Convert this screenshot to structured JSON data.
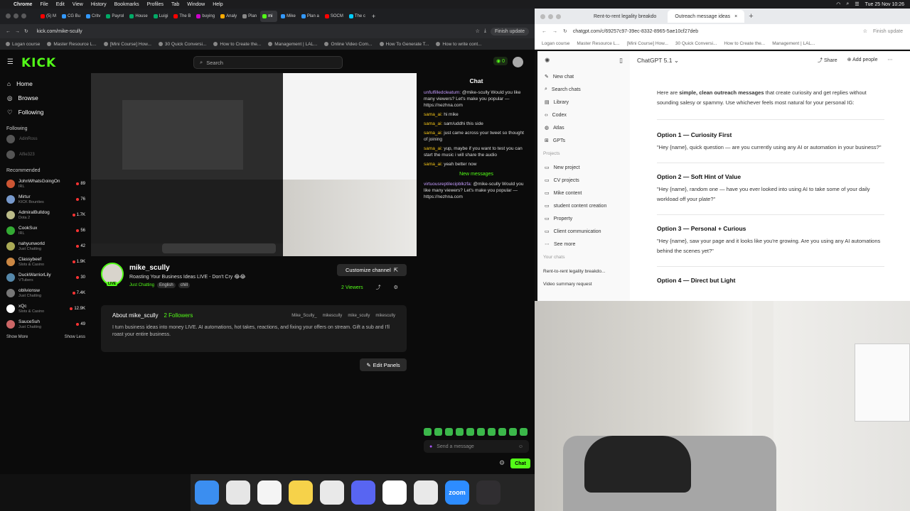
{
  "menubar": {
    "app": "Chrome",
    "items": [
      "File",
      "Edit",
      "View",
      "History",
      "Bookmarks",
      "Profiles",
      "Tab",
      "Window",
      "Help"
    ],
    "datetime": "Tue 25 Nov 10:26"
  },
  "left_browser": {
    "tabs": [
      "(5) M",
      "CG Bu",
      "Critv",
      "Payrol",
      "House",
      "Luigi",
      "The B",
      "buying",
      "Analy",
      "Plan",
      "mi",
      "Mike",
      "Plan a",
      "SOCM",
      "The c"
    ],
    "url": "kick.com/mike-scully",
    "finish_update": "Finish update",
    "bookmarks": [
      "Logan course",
      "Master Resource L...",
      "[Mini Course] How...",
      "30 Quick Conversi...",
      "How to Create the...",
      "Management | LAL...",
      "Online Video Com...",
      "How To Generate T...",
      "How to write cont..."
    ]
  },
  "kick": {
    "search_placeholder": "Search",
    "notif_count": "0",
    "nav": [
      {
        "label": "Home",
        "icon": "home-icon"
      },
      {
        "label": "Browse",
        "icon": "compass-icon"
      },
      {
        "label": "Following",
        "icon": "heart-icon"
      }
    ],
    "following_title": "Following",
    "following": [
      "AdinRoss",
      "Alfie323"
    ],
    "recommended_title": "Recommended",
    "recommended": [
      {
        "name": "JohnWhatsGoingOn",
        "cat": "IRL",
        "viewers": "89"
      },
      {
        "name": "Mirtur",
        "cat": "KICK Bounties",
        "viewers": "76"
      },
      {
        "name": "AdmiralBulldog",
        "cat": "Dota 2",
        "viewers": "1.7K"
      },
      {
        "name": "CookSux",
        "cat": "IRL",
        "viewers": "56"
      },
      {
        "name": "nahyunworld",
        "cat": "Just Chatting",
        "viewers": "42"
      },
      {
        "name": "Classybeef",
        "cat": "Slots & Casino",
        "viewers": "1.9K"
      },
      {
        "name": "DuckWarriorLily",
        "cat": "VTubers",
        "viewers": "30"
      },
      {
        "name": "oblivionsw",
        "cat": "Just Chatting",
        "viewers": "7.4K"
      },
      {
        "name": "xQc",
        "cat": "Slots & Casino",
        "viewers": "12.9K"
      },
      {
        "name": "SauceSuh",
        "cat": "Just Chatting",
        "viewers": "49"
      }
    ],
    "show_more": "Show More",
    "show_less": "Show Less",
    "channel": {
      "name": "mike_scully",
      "title": "Roasting Your Business Ideas LIVE - Don't Cry 😂😂",
      "category": "Just Chatting",
      "tags": [
        "English",
        "chill"
      ],
      "viewers": "2 Viewers",
      "live": "LIVE",
      "customize": "Customize channel"
    },
    "about": {
      "title": "About mike_scully",
      "followers": "2 Followers",
      "socials": [
        "Mike_Scully_",
        "mikescully",
        "mike_scully",
        "mikescully"
      ],
      "bio": "I turn business ideas into money LIVE. AI automations, hot takes, reactions, and fixing your offers on stream. Gift a sub and I'll roast your entire business."
    },
    "edit_panels": "Edit Panels",
    "chat": {
      "title": "Chat",
      "messages": [
        {
          "user": "unfulfilledcleatum:",
          "text": "@mike-scully Would you like many viewers? Let's make you popular — https://nezhna.com"
        },
        {
          "user": "sama_ai:",
          "text": "hi mike"
        },
        {
          "user": "sama_ai:",
          "text": "sam/uddhi this side"
        },
        {
          "user": "sama_ai:",
          "text": "just came across your tweet so thought of joining"
        },
        {
          "user": "sama_ai:",
          "text": "yup, maybe if you want to test you can start the music i will share the audio"
        },
        {
          "user": "sama_ai:",
          "text": "yeah better now"
        }
      ],
      "new_messages": "New messages",
      "last": {
        "user": "virtuousreptilecipblkzfa:",
        "text": "@mike-scully Would you like many viewers? Let's make you popular — https://nezhna.com"
      },
      "placeholder": "Send a message",
      "send": "Chat"
    }
  },
  "right_browser": {
    "tabs": [
      "Rent-to-rent legality breakdo",
      "Outreach message ideas"
    ],
    "url": "chatgpt.com/c/69257c97-39ec-8332-8965-5ae10cf27deb",
    "finish_update": "Finish update",
    "bookmarks": [
      "Logan course",
      "Master Resource L...",
      "[Mini Course] How...",
      "30 Quick Conversi...",
      "How to Create the...",
      "Management | LAL..."
    ],
    "side": {
      "items": [
        "New chat",
        "Search chats",
        "Library",
        "Codex",
        "Atlas",
        "GPTs"
      ],
      "projects_title": "Projects",
      "projects": [
        "New project",
        "CV projects",
        "Mike content",
        "student content creation",
        "Property",
        "Client communication",
        "See more"
      ],
      "chats_title": "Your chats",
      "chats": [
        "Rent-to-rent legality breakdo...",
        "Video summary request"
      ]
    },
    "model": "ChatGPT 5.1",
    "share": "Share",
    "add_people": "Add people",
    "intro_pre": "Here are ",
    "intro_bold": "simple, clean outreach messages",
    "intro_post": " that create curiosity and get replies without sounding salesy or spammy. Use whichever feels most natural for your personal IG:",
    "options": [
      {
        "title": "Option 1 — Curiosity First",
        "text": "\"Hey {name}, quick question — are you currently using any AI or automation in your business?\""
      },
      {
        "title": "Option 2 — Soft Hint of Value",
        "text": "\"Hey {name}, random one — have you ever looked into using AI to take some of your daily workload off your plate?\""
      },
      {
        "title": "Option 3 — Personal + Curious",
        "text": "\"Hey {name}, saw your page and it looks like you're growing. Are you using any AI automations behind the scenes yet?\""
      },
      {
        "title": "Option 4 — Direct but Light",
        "text": ""
      }
    ]
  },
  "dock": [
    {
      "name": "Finder",
      "color": "#3b8ef0"
    },
    {
      "name": "Launchpad",
      "color": "#e6e6e6"
    },
    {
      "name": "Photos",
      "color": "#f4f4f4"
    },
    {
      "name": "Notes",
      "color": "#f6d24a"
    },
    {
      "name": "Chrome",
      "color": "#e9e9e9"
    },
    {
      "name": "Discord",
      "color": "#5865f2"
    },
    {
      "name": "Slack",
      "color": "#ffffff"
    },
    {
      "name": "Chrome",
      "color": "#e9e9e9"
    },
    {
      "name": "Zoom",
      "color": "#2d8cff"
    },
    {
      "name": "OBS",
      "color": "#302e31"
    }
  ],
  "dock_labels": {
    "zoom": "zoom"
  }
}
